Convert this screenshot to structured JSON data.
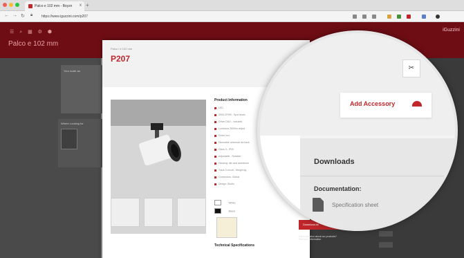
{
  "browser": {
    "tab_title": "Palco e 102 mm - Boyzn",
    "url": "https://www.iguzzini.com/p207",
    "new_tab": "+",
    "close": "x"
  },
  "site": {
    "title": "Palco e 102 mm",
    "header_right": "iGuzzini"
  },
  "left": {
    "box1_text": "Your scale as",
    "box2_text": "Where Looking for"
  },
  "product": {
    "breadcrumb": "Palco / e 102 mm",
    "code": "P207",
    "info_title": "Product Information",
    "info_items": [
      "LED",
      "3000 CRI90 - Spot beam",
      "Driver DALI - included",
      "Luminous 2500lm output",
      "Driver incl.",
      "Dimmable universal via track",
      "Class II - IP20",
      "Adjustable - Rotation",
      "Housing: die-cast aluminium",
      "Track 3 circuit - Weight kg",
      "Connectors: Global",
      "Design: Studio"
    ],
    "color_white": "White",
    "color_black": "Black",
    "tech_specs": "Technical Specifications"
  },
  "magnifier": {
    "add_accessory": "Add Accessory",
    "downloads": "Downloads",
    "documentation": "Documentation:",
    "spec_sheet": "Specification sheet"
  },
  "bottom": {
    "download_all": "Download All",
    "question": "Get a question about our products?",
    "warranty": "Warranty information"
  },
  "icons": {
    "accessory": "lamp-icon",
    "tools": "scissors-icon",
    "pdf": "pdf-icon"
  },
  "colors": {
    "brand": "#c0262a",
    "header": "#6f0d14"
  }
}
